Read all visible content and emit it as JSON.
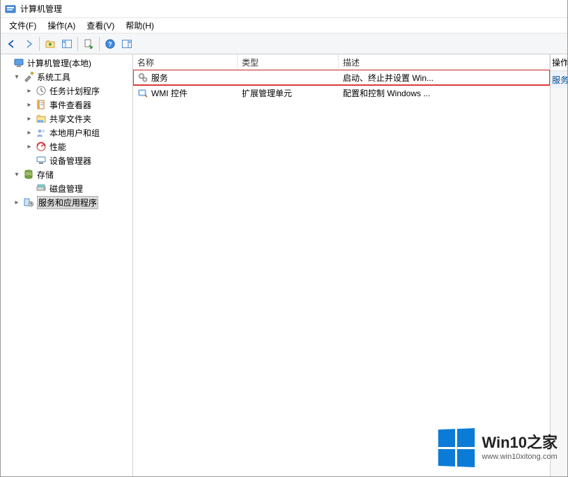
{
  "titlebar": {
    "title": "计算机管理"
  },
  "menu": {
    "file": "文件(F)",
    "action": "操作(A)",
    "view": "查看(V)",
    "help": "帮助(H)"
  },
  "tree": {
    "root": "计算机管理(本地)",
    "system_tools": "系统工具",
    "task_scheduler": "任务计划程序",
    "event_viewer": "事件查看器",
    "shared_folders": "共享文件夹",
    "local_users": "本地用户和组",
    "performance": "性能",
    "device_manager": "设备管理器",
    "storage": "存储",
    "disk_management": "磁盘管理",
    "services_apps": "服务和应用程序"
  },
  "list": {
    "headers": {
      "name": "名称",
      "type": "类型",
      "desc": "描述"
    },
    "rows": [
      {
        "name": "服务",
        "type": "",
        "desc": "启动、终止并设置 Win..."
      },
      {
        "name": "WMI 控件",
        "type": "扩展管理单元",
        "desc": "配置和控制 Windows ..."
      }
    ]
  },
  "actions_pane": {
    "header": "操作",
    "item": "服务"
  },
  "watermark": {
    "title": "Win10之家",
    "url": "www.win10xitong.com"
  }
}
